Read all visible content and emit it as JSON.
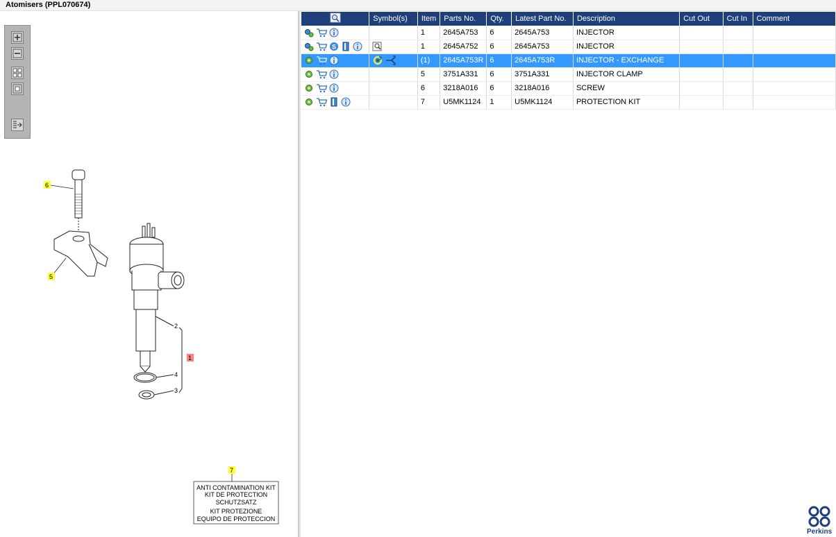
{
  "window": {
    "title": "Atomisers (PPL070674)"
  },
  "toolbar": {
    "buttons": [
      "zoom-in",
      "zoom-out",
      "fit-all",
      "fit-window",
      "expand-panel"
    ]
  },
  "diagram": {
    "callouts": [
      "6",
      "5",
      "1",
      "2",
      "4",
      "3",
      "7"
    ],
    "kit_label": {
      "lines": [
        "ANTI CONTAMINATION KIT",
        "KIT DE PROTECTION",
        "SCHUTZSATZ",
        "KIT PROTEZIONE",
        "EQUIPO DE PROTECCION"
      ]
    }
  },
  "grid": {
    "columns": [
      "Symbol(s)",
      "Item",
      "Parts No.",
      "Qty.",
      "Latest Part No.",
      "Description",
      "Cut Out",
      "Cut In",
      "Comment"
    ],
    "rows": [
      {
        "item": "1",
        "part_no": "2645A753",
        "qty": "6",
        "latest": "2645A753",
        "description": "INJECTOR",
        "cut_out": "",
        "cut_in": "",
        "comment": "",
        "icons": [
          "gears-icon",
          "cart-icon",
          "info-icon"
        ],
        "symbols": [],
        "selected": false
      },
      {
        "item": "1",
        "part_no": "2645A752",
        "qty": "6",
        "latest": "2645A753",
        "description": "INJECTOR",
        "cut_out": "",
        "cut_in": "",
        "comment": "",
        "icons": [
          "gears-icon",
          "cart-icon",
          "s-icon",
          "book-icon",
          "info-icon"
        ],
        "symbols": [
          "magnifier-doc-icon"
        ],
        "selected": false
      },
      {
        "item": "(1)",
        "part_no": "2645A753R",
        "qty": "6",
        "latest": "2645A753R",
        "description": "INJECTOR - EXCHANGE",
        "cut_out": "",
        "cut_in": "",
        "comment": "",
        "icons": [
          "gear-icon",
          "cart-icon",
          "info-icon"
        ],
        "symbols": [
          "exchange-icon",
          "link-arrow-icon"
        ],
        "selected": true
      },
      {
        "item": "5",
        "part_no": "3751A331",
        "qty": "6",
        "latest": "3751A331",
        "description": "INJECTOR CLAMP",
        "cut_out": "",
        "cut_in": "",
        "comment": "",
        "icons": [
          "gear-icon",
          "cart-icon",
          "info-icon"
        ],
        "symbols": [],
        "selected": false
      },
      {
        "item": "6",
        "part_no": "3218A016",
        "qty": "6",
        "latest": "3218A016",
        "description": "SCREW",
        "cut_out": "",
        "cut_in": "",
        "comment": "",
        "icons": [
          "gear-icon",
          "cart-icon",
          "info-icon"
        ],
        "symbols": [],
        "selected": false
      },
      {
        "item": "7",
        "part_no": "U5MK1124",
        "qty": "1",
        "latest": "U5MK1124",
        "description": "PROTECTION KIT",
        "cut_out": "",
        "cut_in": "",
        "comment": "",
        "icons": [
          "gear-icon",
          "cart-icon",
          "book-icon",
          "info-icon"
        ],
        "symbols": [],
        "selected": false
      }
    ]
  },
  "brand": {
    "name": "Perkins",
    "color": "#1e3f7c"
  },
  "colors": {
    "header_bg": "#1e3f7c",
    "selection": "#3399ff",
    "callout_yellow": "#ffff33",
    "callout_red": "#ff8080"
  }
}
